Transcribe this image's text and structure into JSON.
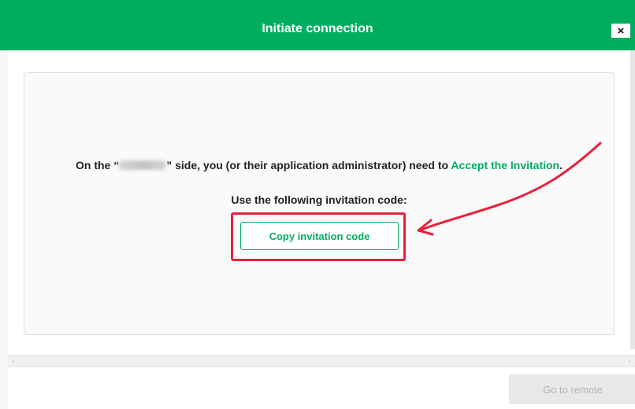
{
  "dialog": {
    "title": "Initiate connection",
    "close_symbol": "×"
  },
  "message": {
    "prefix": "On the “",
    "suffix": "” side, you (or their application administrator) need to ",
    "link": "Accept the Invitation",
    "end": "."
  },
  "code_label": "Use the following invitation code:",
  "copy_button_label": "Copy invitation code",
  "footer": {
    "go_to_remote_label": "Go to remote"
  },
  "scrollbar": {
    "left_icon": "chevron-left-icon",
    "right_icon": "chevron-right-icon",
    "left_glyph": "‹",
    "right_glyph": "›"
  },
  "colors": {
    "accent": "#00ad5f",
    "annotation": "#e8213a"
  }
}
